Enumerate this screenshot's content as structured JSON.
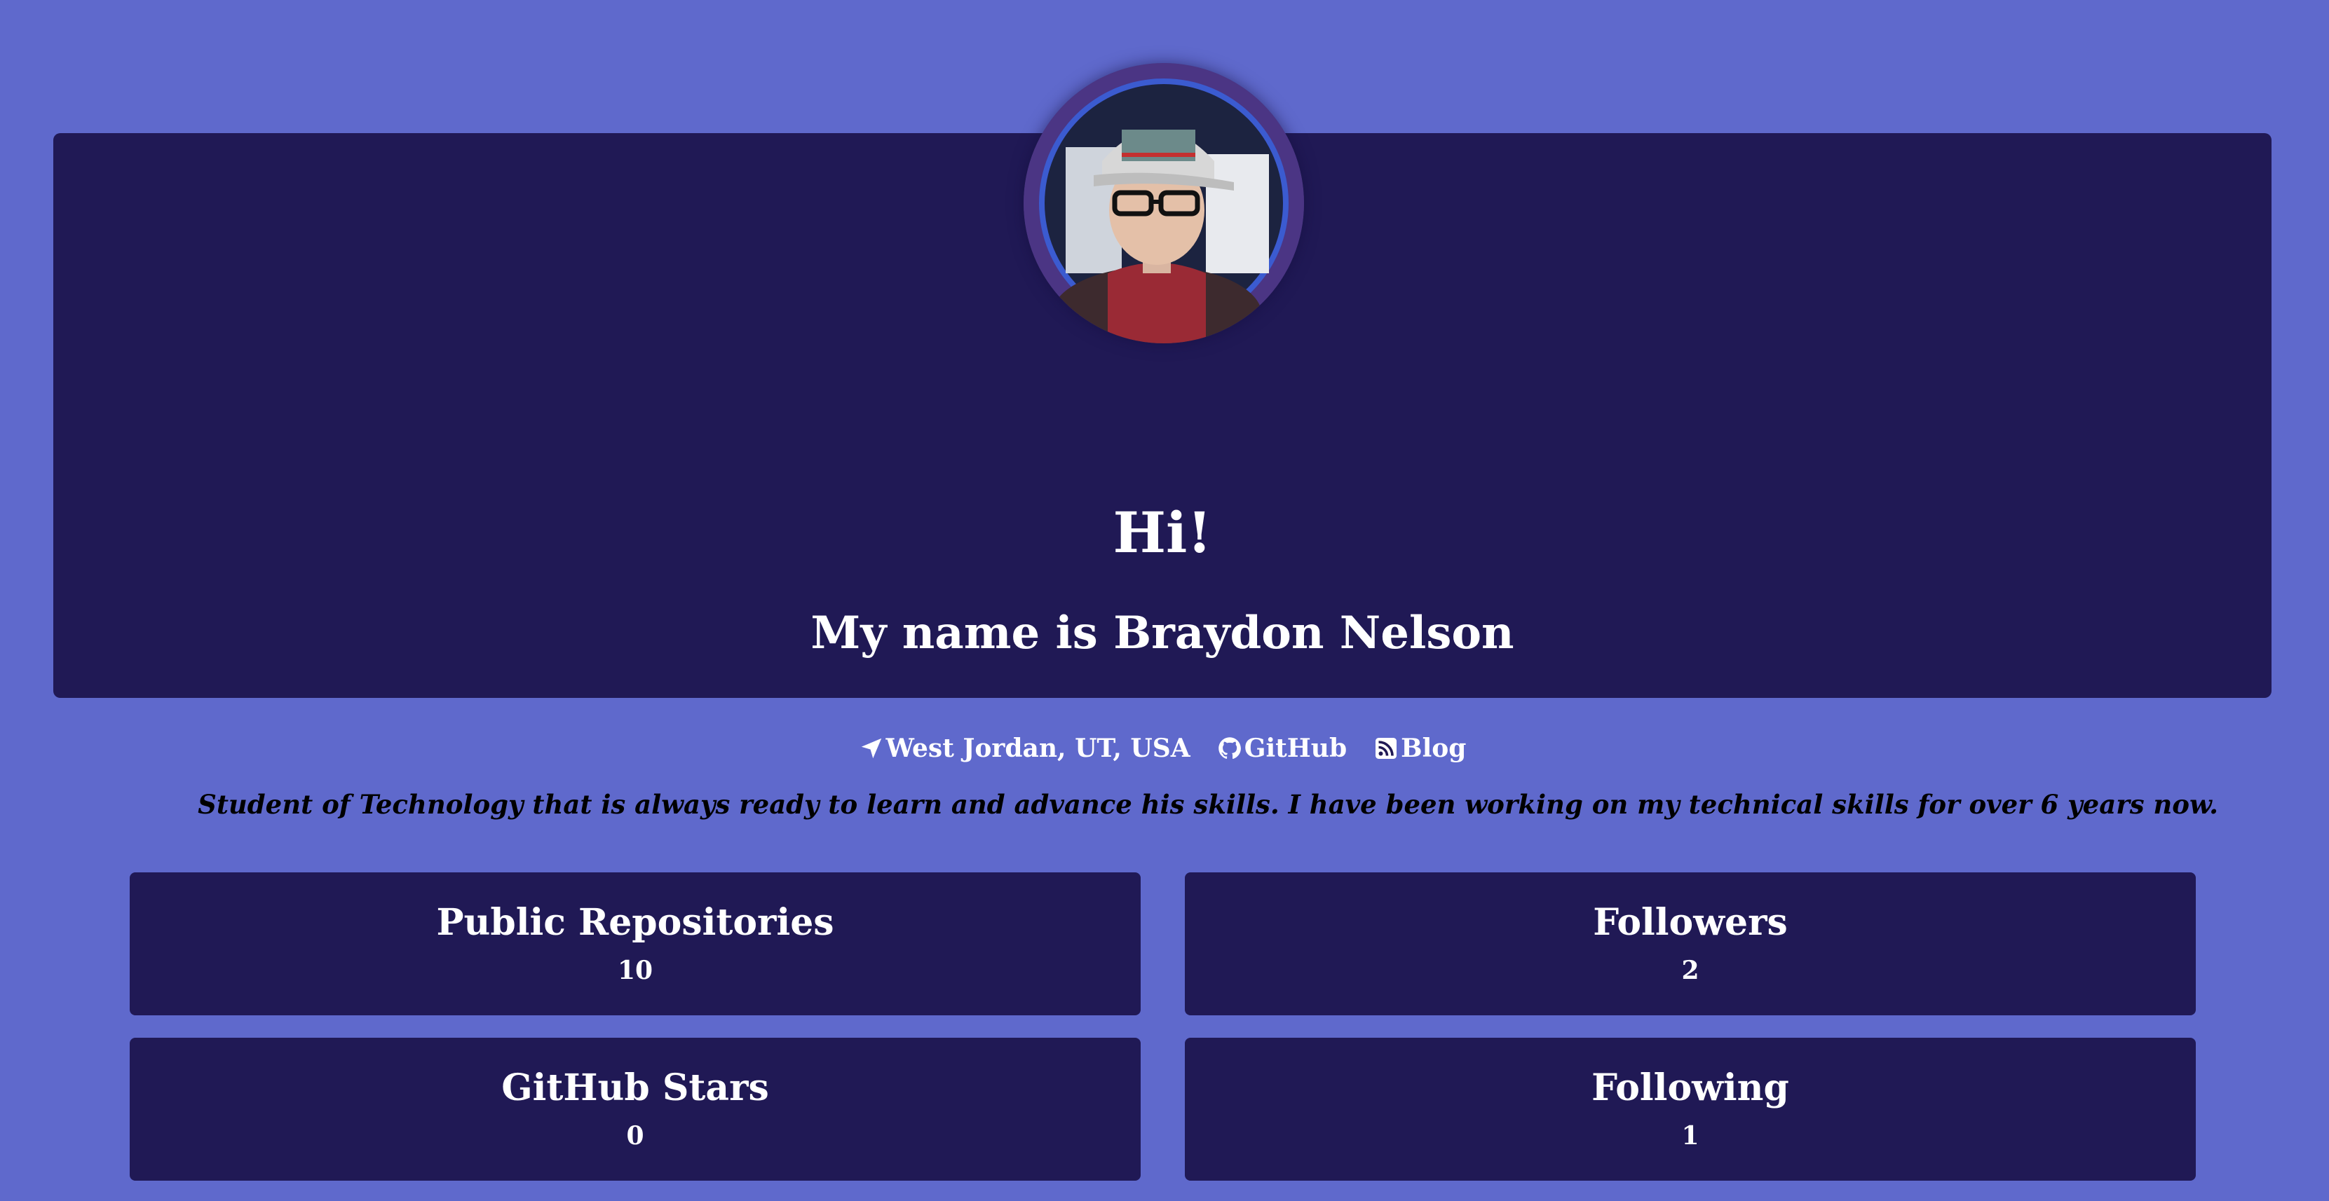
{
  "colors": {
    "page_background": "#5f69cc",
    "panel_background": "#201955",
    "avatar_ring": "#4b3584",
    "text_light": "#ffffff",
    "text_dark": "#000000"
  },
  "profile": {
    "avatar_alt": "profile-photo",
    "greeting": "Hi!",
    "name_line": "My name is Braydon Nelson"
  },
  "links": [
    {
      "icon": "location-arrow-icon",
      "label": "West Jordan, UT, USA"
    },
    {
      "icon": "github-icon",
      "label": "GitHub"
    },
    {
      "icon": "rss-icon",
      "label": "Blog"
    }
  ],
  "bio": "Student of Technology that is always ready to learn and advance his skills. I have been working on my technical skills for over 6 years now.",
  "stats": {
    "public_repositories": {
      "label": "Public Repositories",
      "value": "10"
    },
    "followers": {
      "label": "Followers",
      "value": "2"
    },
    "github_stars": {
      "label": "GitHub Stars",
      "value": "0"
    },
    "following": {
      "label": "Following",
      "value": "1"
    }
  }
}
